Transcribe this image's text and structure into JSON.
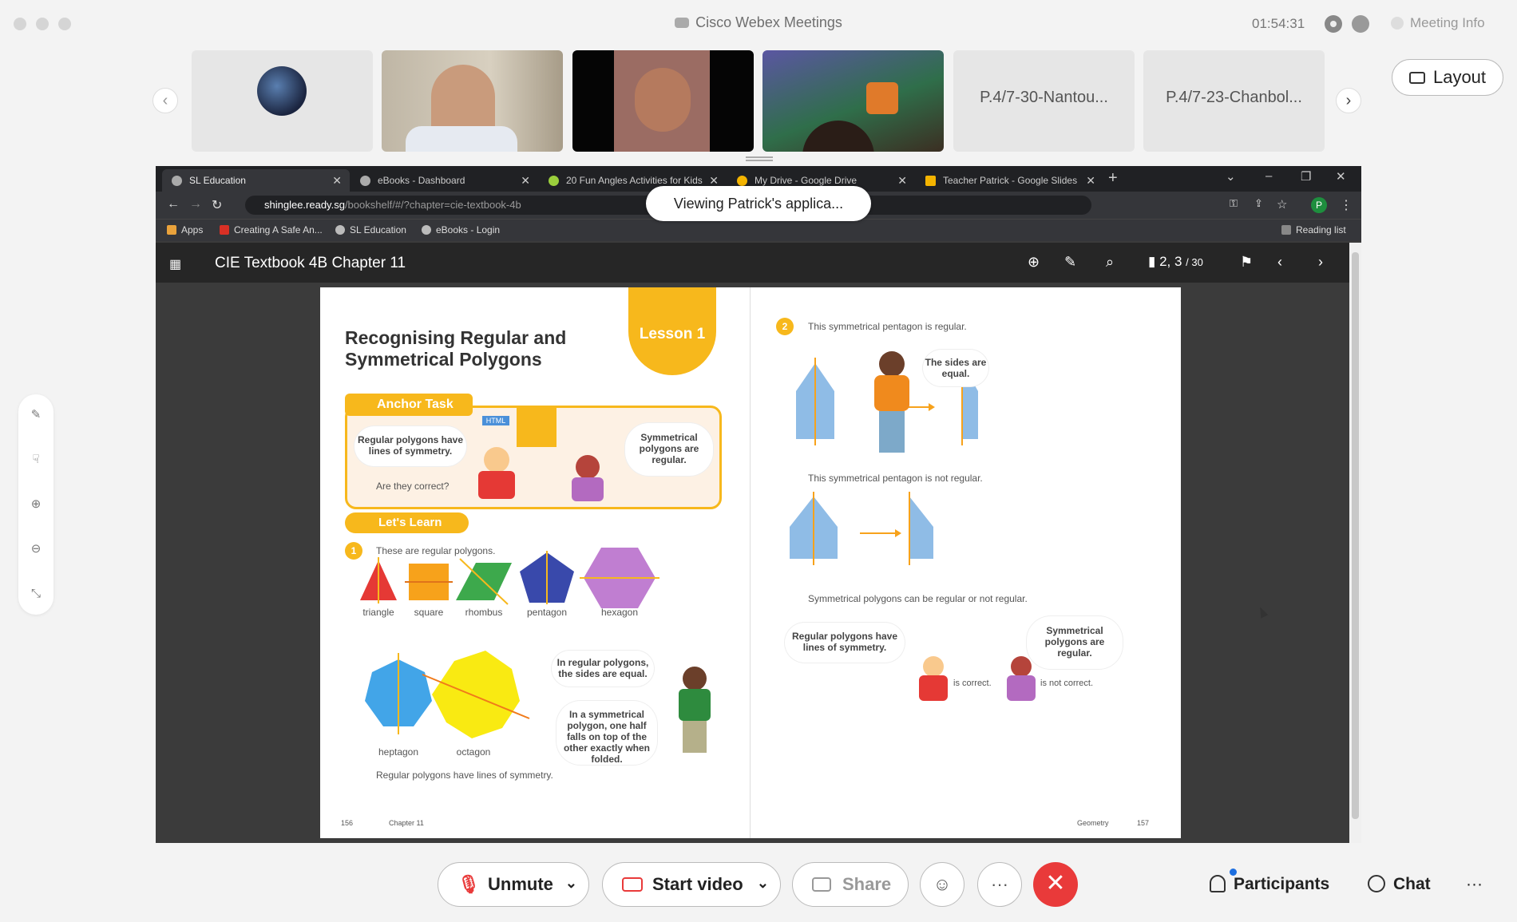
{
  "window": {
    "title": "Cisco Webex Meetings",
    "timer": "01:54:31",
    "meeting_info": "Meeting Info"
  },
  "participants_strip": {
    "thumbs": [
      {
        "type": "avatar"
      },
      {
        "type": "video"
      },
      {
        "type": "video"
      },
      {
        "type": "video"
      },
      {
        "type": "name",
        "label": "P.4/7-30-Nantou..."
      },
      {
        "type": "name",
        "label": "P.4/7-23-Chanbol..."
      }
    ],
    "layout_label": "Layout"
  },
  "browser": {
    "tabs": [
      {
        "label": "SL Education",
        "active": true
      },
      {
        "label": "eBooks - Dashboard"
      },
      {
        "label": "20 Fun Angles Activities for Kids"
      },
      {
        "label": "My Drive - Google Drive"
      },
      {
        "label": "Teacher Patrick - Google Slides"
      }
    ],
    "url_host": "shinglee.ready.sg",
    "url_path": "/bookshelf/#/?chapter=cie-textbook-4b",
    "bookmarks": [
      "Apps",
      "Creating A Safe An...",
      "SL Education",
      "eBooks - Login"
    ],
    "reading_list": "Reading list",
    "profile_initial": "P"
  },
  "viewing_banner": "Viewing Patrick's applica...",
  "reader": {
    "title": "CIE Textbook 4B Chapter 11",
    "page_current": "2, 3",
    "page_total": "/ 30"
  },
  "book": {
    "left": {
      "title": "Recognising Regular and Symmetrical Polygons",
      "lesson": "Lesson 1",
      "anchor_task": "Anchor Task",
      "html_tag": "HTML",
      "bubble1": "Regular polygons have lines of symmetry.",
      "bubble2": "Symmetrical polygons are regular.",
      "question": "Are they correct?",
      "lets_learn": "Let's Learn",
      "num1": "1",
      "intro": "These are regular polygons.",
      "shapes": [
        "triangle",
        "square",
        "rhombus",
        "pentagon",
        "hexagon",
        "heptagon",
        "octagon"
      ],
      "bubble3": "In regular polygons, the sides are equal.",
      "bubble4": "In a symmetrical polygon, one half falls on top of the other exactly when folded.",
      "footer_note": "Regular polygons have lines of symmetry.",
      "page_num": "156",
      "chapter": "Chapter 11"
    },
    "right": {
      "num2": "2",
      "line1": "This symmetrical pentagon is regular.",
      "bubble_sides": "The sides are equal.",
      "line2": "This symmetrical pentagon is not regular.",
      "line3": "Symmetrical polygons can be regular or not regular.",
      "bubble5": "Regular polygons have lines of symmetry.",
      "bubble6": "Symmetrical polygons are regular.",
      "correct": "is correct.",
      "not_correct": "is not correct.",
      "section": "Geometry",
      "page_num": "157"
    }
  },
  "controls": {
    "unmute": "Unmute",
    "start_video": "Start video",
    "share": "Share",
    "more": "···",
    "participants": "Participants",
    "chat": "Chat",
    "overflow": "···"
  },
  "colors": {
    "leave": "#e93a3a",
    "accent": "#f7b81c"
  }
}
